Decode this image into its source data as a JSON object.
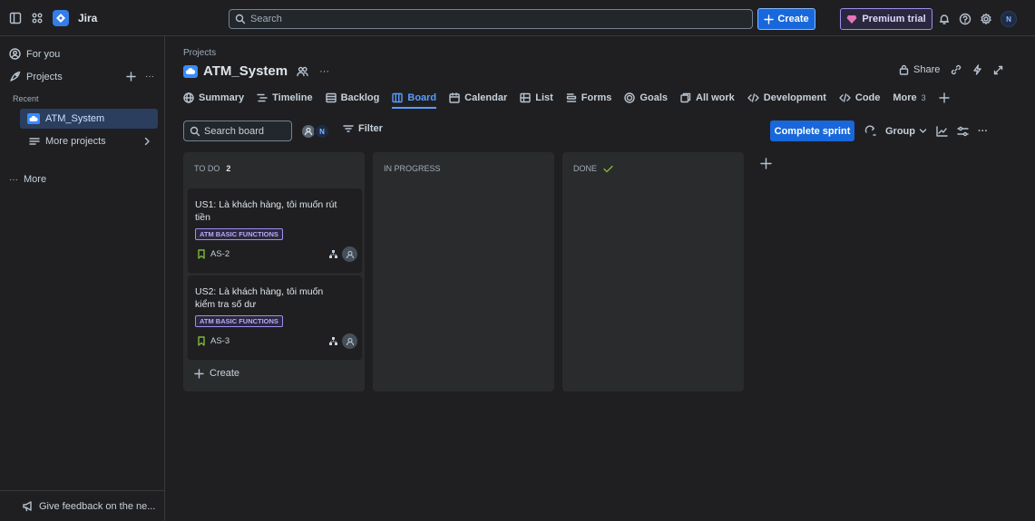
{
  "topbar": {
    "app_name": "Jira",
    "search_placeholder": "Search",
    "create_label": "Create",
    "premium_label": "Premium trial",
    "avatar_initial": "N"
  },
  "sidebar": {
    "for_you": "For you",
    "projects": "Projects",
    "recent": "Recent",
    "recent_project": "ATM_System",
    "more_projects": "More projects",
    "more": "More",
    "feedback": "Give feedback on the ne..."
  },
  "header": {
    "breadcrumb": "Projects",
    "project_title": "ATM_System",
    "share_label": "Share"
  },
  "tabs": [
    {
      "label": "Summary",
      "icon": "globe-icon"
    },
    {
      "label": "Timeline",
      "icon": "timeline-icon"
    },
    {
      "label": "Backlog",
      "icon": "backlog-icon"
    },
    {
      "label": "Board",
      "icon": "board-icon",
      "active": true
    },
    {
      "label": "Calendar",
      "icon": "calendar-icon"
    },
    {
      "label": "List",
      "icon": "list-icon"
    },
    {
      "label": "Forms",
      "icon": "forms-icon"
    },
    {
      "label": "Goals",
      "icon": "goals-icon"
    },
    {
      "label": "All work",
      "icon": "all-work-icon"
    },
    {
      "label": "Development",
      "icon": "development-icon"
    },
    {
      "label": "Code",
      "icon": "code-icon"
    },
    {
      "label": "More",
      "count": "3"
    }
  ],
  "toolbar": {
    "search_placeholder": "Search board",
    "filter_label": "Filter",
    "complete_sprint_label": "Complete sprint",
    "group_label": "Group",
    "avatar_initial": "N"
  },
  "columns": [
    {
      "title": "TO DO",
      "count": "2",
      "create_label": "Create",
      "cards": [
        {
          "title": "US1: Là khách hàng, tôi muốn rút tiền",
          "label": "ATM BASIC FUNCTIONS",
          "key": "AS-2"
        },
        {
          "title": "US2: Là khách hàng, tôi muốn kiểm tra số dư",
          "label": "ATM BASIC FUNCTIONS",
          "key": "AS-3"
        }
      ]
    },
    {
      "title": "IN PROGRESS"
    },
    {
      "title": "DONE"
    }
  ],
  "colors": {
    "accent": "#579dff",
    "primary_button": "#1868db",
    "label_purple": "#9f8fef",
    "done_check": "#82b536"
  }
}
